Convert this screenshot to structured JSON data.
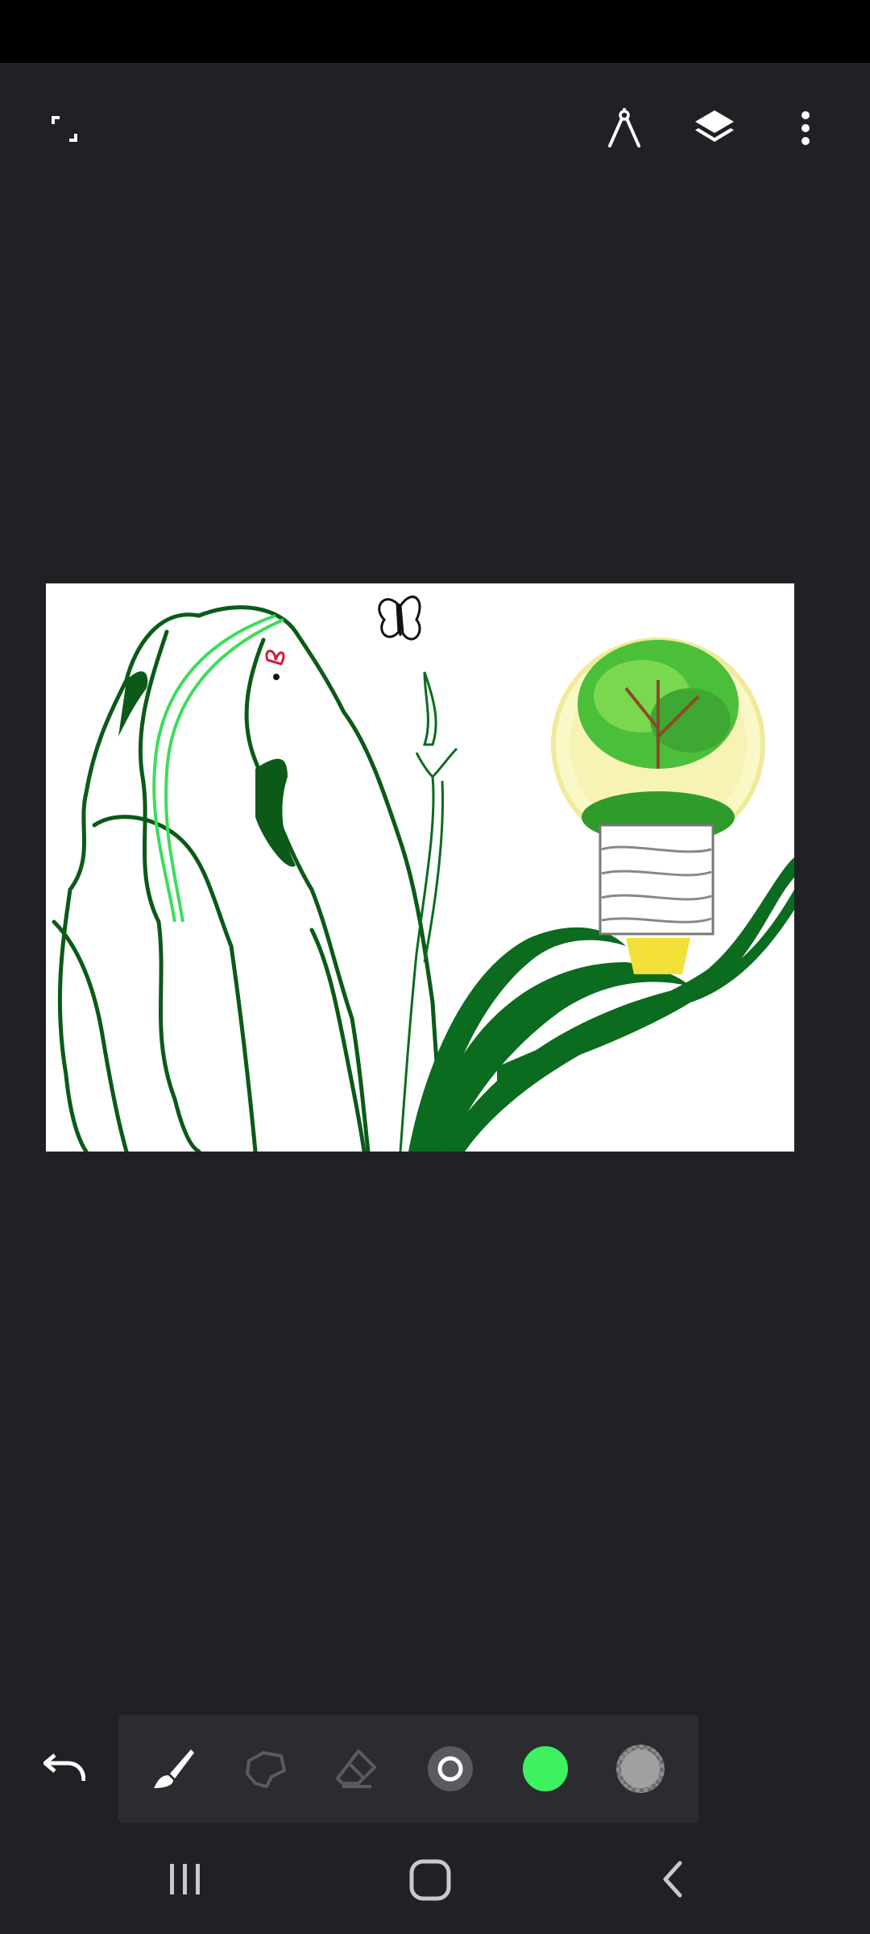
{
  "app": {
    "screen": "drawing-canvas"
  },
  "top_bar": {
    "left_icon": "fullscreen-icon",
    "right_icons": [
      "ruler-compass-icon",
      "layers-icon",
      "more-vert-icon"
    ]
  },
  "canvas": {
    "background": "#ffffff",
    "accent_dark_green": "#0b6b1e",
    "accent_light_green": "#3ddc5a",
    "bulb_yellow": "#f3e13a"
  },
  "toolbar": {
    "undo_icon": "undo-icon",
    "tools": [
      {
        "name": "brush-icon",
        "active": true
      },
      {
        "name": "lasso-icon",
        "active": false
      },
      {
        "name": "eraser-icon",
        "active": false
      },
      {
        "name": "brush-size-icon",
        "active": false
      },
      {
        "name": "color-swatch",
        "color": "#3ef25f"
      },
      {
        "name": "opacity-swatch",
        "color": "#a0a0a0"
      }
    ]
  },
  "nav": {
    "icons": [
      "recent-apps-icon",
      "home-icon",
      "back-icon"
    ]
  },
  "colors": {
    "background": "#202124",
    "toolbar": "#2b2c2f",
    "status_bar": "#000000",
    "icon": "#ffffff"
  }
}
